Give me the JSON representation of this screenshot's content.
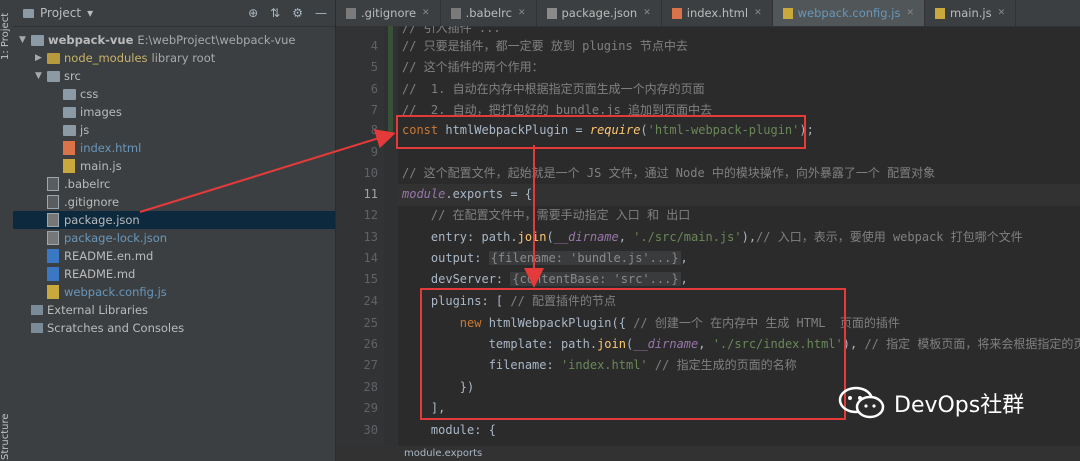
{
  "side_strip": {
    "top_label": "1: Project",
    "bottom_label": "Structure"
  },
  "project": {
    "title": "Project",
    "dropdown_glyph": "▾",
    "tools": [
      "⊕",
      "⇅",
      "⚙",
      "—"
    ],
    "tree": [
      {
        "name": "webpack-vue",
        "extra": "E:\\webProject\\webpack-vue",
        "type": "folder",
        "depth": 0,
        "expanded": true,
        "bold": true
      },
      {
        "name": "node_modules",
        "extra": "library root",
        "type": "folder-nm",
        "depth": 1,
        "expanded": false
      },
      {
        "name": "src",
        "extra": "",
        "type": "folder",
        "depth": 1,
        "expanded": true
      },
      {
        "name": "css",
        "extra": "",
        "type": "folder",
        "depth": 2
      },
      {
        "name": "images",
        "extra": "",
        "type": "folder",
        "depth": 2
      },
      {
        "name": "js",
        "extra": "",
        "type": "folder",
        "depth": 2
      },
      {
        "name": "index.html",
        "extra": "",
        "type": "html",
        "depth": 2,
        "color": "blue"
      },
      {
        "name": "main.js",
        "extra": "",
        "type": "js",
        "depth": 2
      },
      {
        "name": ".babelrc",
        "extra": "",
        "type": "file",
        "depth": 1
      },
      {
        "name": ".gitignore",
        "extra": "",
        "type": "file",
        "depth": 1
      },
      {
        "name": "package.json",
        "extra": "",
        "type": "json",
        "depth": 1,
        "selected": true
      },
      {
        "name": "package-lock.json",
        "extra": "",
        "type": "json",
        "depth": 1,
        "color": "blue"
      },
      {
        "name": "README.en.md",
        "extra": "",
        "type": "md",
        "depth": 1
      },
      {
        "name": "README.md",
        "extra": "",
        "type": "md",
        "depth": 1
      },
      {
        "name": "webpack.config.js",
        "extra": "",
        "type": "js",
        "depth": 1,
        "color": "blue"
      },
      {
        "name": "External Libraries",
        "extra": "",
        "type": "lib",
        "depth": 0
      },
      {
        "name": "Scratches and Consoles",
        "extra": "",
        "type": "scratch",
        "depth": 0
      }
    ]
  },
  "tabs": [
    {
      "label": ".gitignore",
      "active": false
    },
    {
      "label": ".babelrc",
      "active": false
    },
    {
      "label": "package.json",
      "active": false
    },
    {
      "label": "index.html",
      "active": false
    },
    {
      "label": "webpack.config.js",
      "active": true
    },
    {
      "label": "main.js",
      "active": false
    }
  ],
  "line_numbers": [
    "4",
    "5",
    "6",
    "7",
    "8",
    "9",
    "10",
    "11",
    "12",
    "13",
    "14",
    "15",
    "24",
    "25",
    "26",
    "27",
    "28",
    "29",
    "30"
  ],
  "code": {
    "l4": "// 只要是插件，都一定要 放到 plugins 节点中去",
    "l5": "// 这个插件的两个作用：",
    "l6": "//  1. 自动在内存中根据指定页面生成一个内存的页面",
    "l7": "//  2. 自动，把打包好的 bundle.js 追加到页面中去",
    "l8_kw": "const",
    "l8_var": " htmlWebpackPlugin = ",
    "l8_fn": "require",
    "l8_str": "'html-webpack-plugin'",
    "l8_end": ");",
    "l10": "// 这个配置文件，起始就是一个 JS 文件，通过 Node 中的模块操作，向外暴露了一个 配置对象",
    "l11_a": "module",
    "l11_b": ".exports = {",
    "l12": "    // 在配置文件中，需要手动指定 入口 和 出口",
    "l13_a": "    entry: path.",
    "l13_fn": "join",
    "l13_b": "(",
    "l13_it": "__dirname",
    "l13_c": ", ",
    "l13_s": "'./src/main.js'",
    "l13_d": "),",
    "l13_cm": "// 入口，表示，要使用 webpack 打包哪个文件",
    "l14_a": "    output: ",
    "l14_fold": "{filename: 'bundle.js'...}",
    "l14_b": ",",
    "l15_a": "    devServer: ",
    "l15_fold": "{contentBase: 'src'...}",
    "l15_b": ",",
    "l24_a": "    plugins: [ ",
    "l24_cm": "// 配置插件的节点",
    "l25_kw": "        new",
    "l25_a": " htmlWebpackPlugin({ ",
    "l25_cm": "// 创建一个 在内存中 生成 HTML  页面的插件",
    "l26_a": "            template: path.",
    "l26_fn": "join",
    "l26_b": "(",
    "l26_it": "__dirname",
    "l26_c": ", ",
    "l26_s": "'./src/index.html'",
    "l26_d": "), ",
    "l26_cm": "// 指定 模板页面，将来会根据指定的页",
    "l27_a": "            filename: ",
    "l27_s": "'index.html'",
    "l27_b": " ",
    "l27_cm": "// 指定生成的页面的名称",
    "l28": "        })",
    "l29": "    ],",
    "l30": "    module: {"
  },
  "status_bar": "module.exports",
  "watermark": "DevOps社群",
  "colors": {
    "annotation": "#e53a3a",
    "keyword": "#cc7832",
    "string": "#6a8759",
    "comment": "#808080"
  }
}
